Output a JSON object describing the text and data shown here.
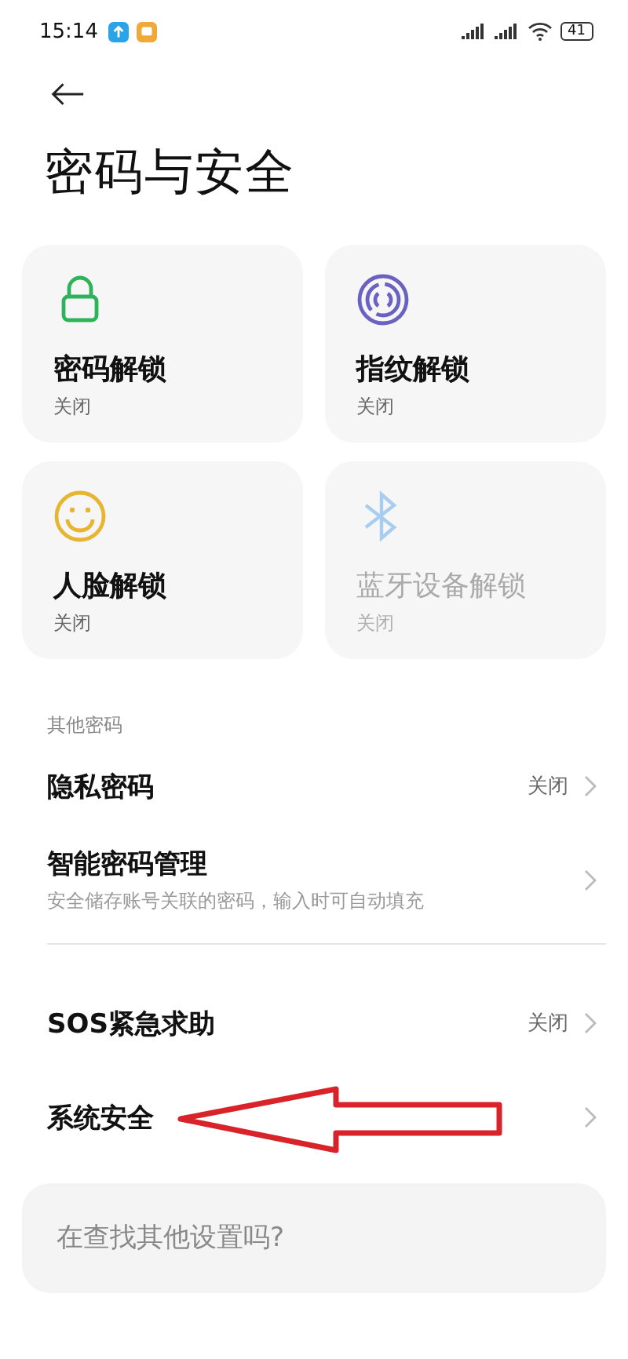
{
  "status_bar": {
    "time": "15:14",
    "battery": "41"
  },
  "title": "密码与安全",
  "unlock_cards": [
    {
      "kind": "lock",
      "title": "密码解锁",
      "status": "关闭",
      "disabled": false
    },
    {
      "kind": "fingerprint",
      "title": "指纹解锁",
      "status": "关闭",
      "disabled": false
    },
    {
      "kind": "face",
      "title": "人脸解锁",
      "status": "关闭",
      "disabled": false
    },
    {
      "kind": "bluetooth",
      "title": "蓝牙设备解锁",
      "status": "关闭",
      "disabled": true
    }
  ],
  "section_label": "其他密码",
  "rows": [
    {
      "title": "隐私密码",
      "value": "关闭"
    },
    {
      "title": "智能密码管理",
      "subtitle": "安全储存账号关联的密码，输入时可自动填充"
    },
    {
      "kind": "divider"
    },
    {
      "title": "SOS紧急求助",
      "value": "关闭"
    },
    {
      "title": "系统安全",
      "annotated": true
    }
  ],
  "search": {
    "placeholder": "在查找其他设置吗?"
  }
}
